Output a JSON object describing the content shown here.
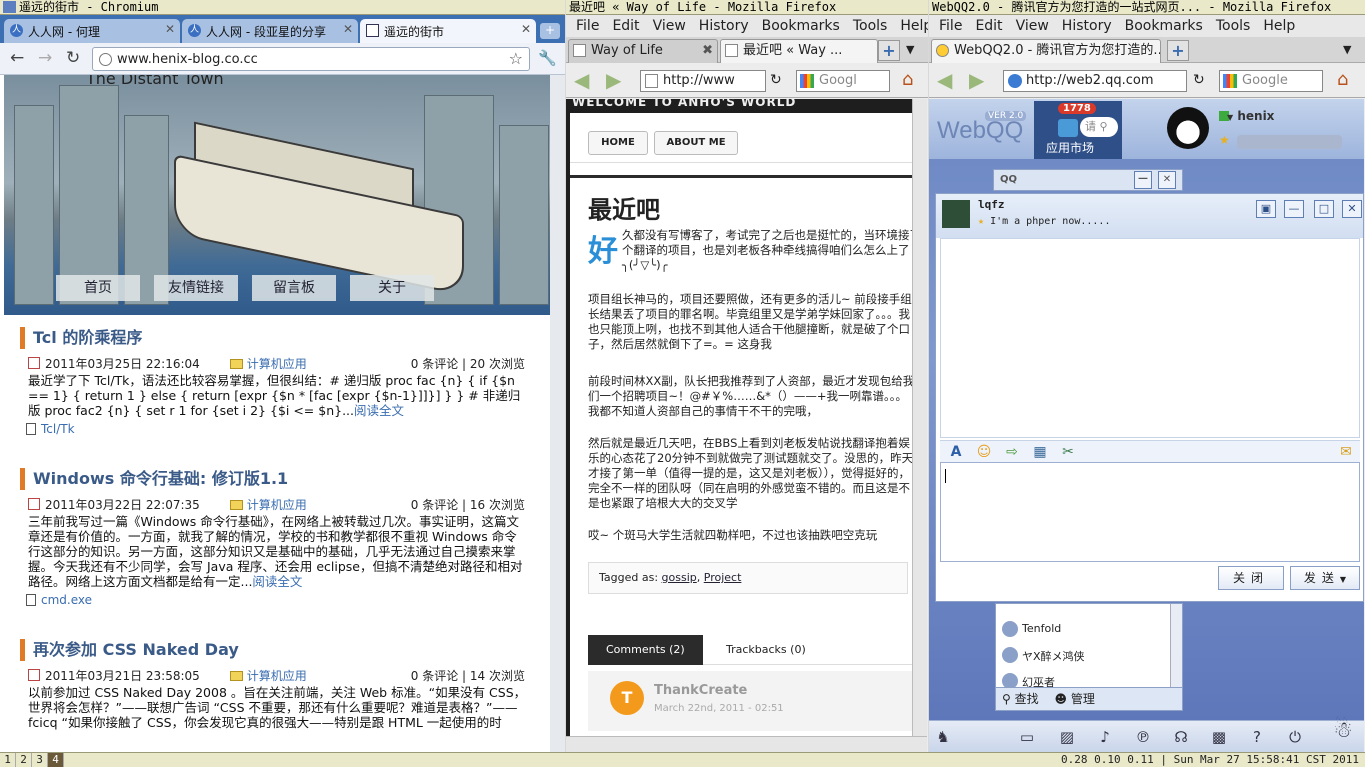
{
  "titlebars": {
    "chromium": "遥远的街市 - Chromium",
    "firefox1": "最近吧 « Way of Life - Mozilla Firefox",
    "firefox2": "WebQQ2.0 - 腾讯官方为您打造的一站式网页... - Mozilla Firefox"
  },
  "chromium": {
    "tabs": [
      "人人网 - 何理",
      "人人网 - 段亚星的分享",
      "遥远的街市"
    ],
    "url": "www.henix-blog.co.cc",
    "site_subtitle": "The Distant Town",
    "nav": [
      "首页",
      "友情链接",
      "留言板",
      "关于"
    ],
    "posts": [
      {
        "title": "Tcl 的阶乘程序",
        "date": "2011年03月25日 22:16:04",
        "category": "计算机应用",
        "stats": "0 条评论 | 20 次浏览",
        "excerpt": "最近学了下 Tcl/Tk，语法还比较容易掌握，但很纠结：# 递归版 proc fac {n} { if {$n == 1} { return 1 } else { return [expr {$n * [fac [expr {$n-1}]]}] } } # 非递归版 proc fac2 {n} { set r 1 for {set i 2} {$i <= $n}...",
        "read_more": "阅读全文",
        "tag": "Tcl/Tk"
      },
      {
        "title": "Windows 命令行基础: 修订版1.1",
        "date": "2011年03月22日 22:07:35",
        "category": "计算机应用",
        "stats": "0 条评论 | 16 次浏览",
        "excerpt": "三年前我写过一篇《Windows 命令行基础》，在网络上被转载过几次。事实证明，这篇文章还是有价值的。一方面，就我了解的情况，学校的书和教学都很不重视 Windows 命令行这部分的知识。另一方面，这部分知识又是基础中的基础，几乎无法通过自己摸索来掌握。今天我还有不少同学，会写 Java 程序、还会用 eclipse，但搞不清楚绝对路径和相对路径。网络上这方面文档都是给有一定...",
        "read_more": "阅读全文",
        "tag": "cmd.exe"
      },
      {
        "title": "再次参加 CSS Naked Day",
        "date": "2011年03月21日 23:58:05",
        "category": "计算机应用",
        "stats": "0 条评论 | 14 次浏览",
        "excerpt": "以前参加过 CSS Naked Day 2008 。旨在关注前端，关注 Web 标准。“如果没有 CSS，世界将会怎样？”——联想广告词 “CSS 不重要，那还有什么重要呢？难道是表格？”——fcicq “如果你接触了 CSS，你会发现它真的很强大——特别是跟 HTML 一起使用的时",
        "read_more": "",
        "tag": ""
      }
    ]
  },
  "firefox1": {
    "menu": [
      "File",
      "Edit",
      "View",
      "History",
      "Bookmarks",
      "Tools",
      "Help"
    ],
    "tabs": [
      "Way of Life",
      "最近吧 « Way ..."
    ],
    "url": "http://www",
    "search_placeholder": "Googl",
    "site_banner": "WELCOME TO ANHO'S WORLD",
    "nav": [
      "HOME",
      "ABOUT ME"
    ],
    "post_title": "最近吧",
    "dropcap": "好",
    "paragraphs": [
      "久都没有写博客了，考试完了之后也是挺忙的，当环境接了个翻译的项目，也是刘老板各种牵线搞得咱们么怎么上了╮(╯▽╰)╭",
      "项目组长神马的，项目还要照做，还有更多的活儿~ 前段接手组长结果丢了项目的罪名啊。毕竟组里又是学弟学妹回家了。。。我也只能顶上咧，也找不到其他人适合干他腿撞断，就是破了个口子，然后居然就倒下了=。= 这身我",
      "前段时间林XX副，队长把我推荐到了人资部，最近才发现包给我们一个招聘项目~！@#￥%……&*（）——+我一咧靠谱。。。我都不知道人资部自己的事情干不干的完哦，",
      "然后就是最近几天吧，在BBS上看到刘老板发帖说找翻译抱着娱乐的心态花了20分钟不到就做完了测试题就交了。没思的，昨天才接了第一单（值得一提的是，这又是刘老板）），觉得挺好的，完全不一样的团队呀（同在启明的外感觉蛮不错的。而且这是不是也紧跟了培根大大的交叉学",
      "哎~ 个斑马大学生活就四勒样吧，不过也该抽跌吧空克玩"
    ],
    "tagged_label": "Tagged as:",
    "tags": [
      "gossip",
      "Project"
    ],
    "comment_tabs": [
      "Comments (2)",
      "Trackbacks (0)"
    ],
    "comment_author": "ThankCreate",
    "comment_date": "March 22nd, 2011 - 02:51"
  },
  "firefox2": {
    "menu": [
      "File",
      "Edit",
      "View",
      "History",
      "Bookmarks",
      "Tools",
      "Help"
    ],
    "tab": "WebQQ2.0 - 腾讯官方为您打造的...",
    "url": "http://web2.qq.com",
    "search_placeholder": "Google",
    "logo": "WebQQ",
    "version": "VER 2.0",
    "market_badge": "1778",
    "market_label": "应用市场",
    "market_search": "请",
    "username": "henix",
    "mini_title": "QQ",
    "chat_name": "lqfz",
    "chat_signature": "I'm a phper now.....",
    "buttons": {
      "close": "关闭",
      "send": "发送"
    },
    "buddies": [
      "Tenfold",
      "ヤX醉メ鸿侠",
      "幻巫者"
    ],
    "buddy_footer": [
      "查找",
      "管理"
    ]
  },
  "statusbar": {
    "workspaces": [
      "1",
      "2",
      "3",
      "4"
    ],
    "active_workspace": "4",
    "right": "0.28 0.10 0.11 | Sun Mar 27 15:58:41 CST 2011"
  }
}
